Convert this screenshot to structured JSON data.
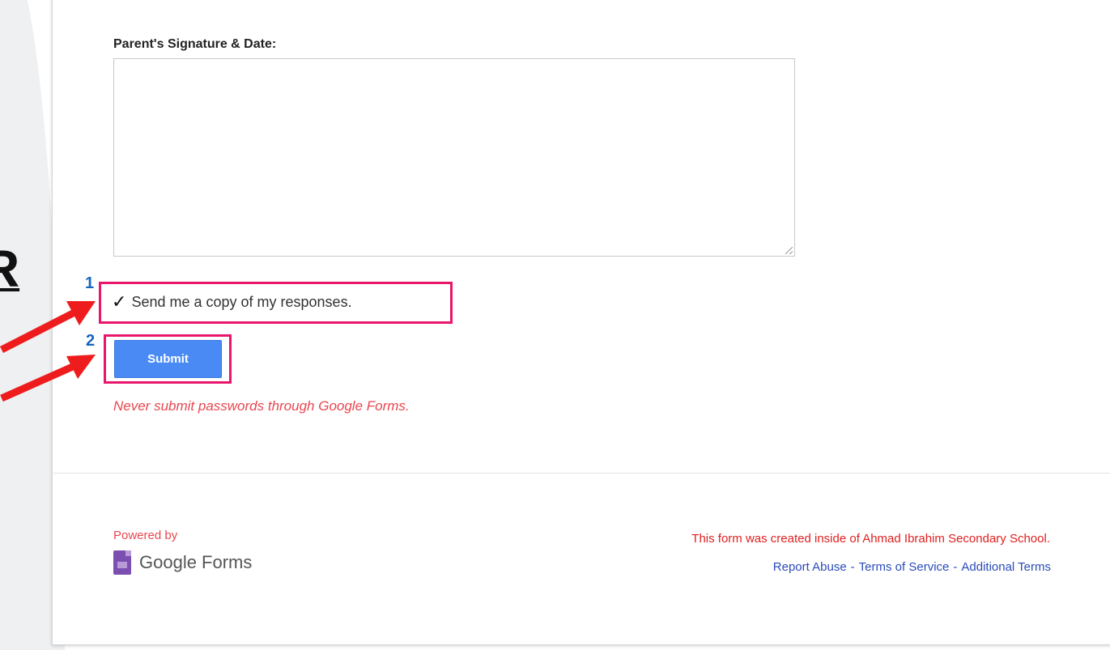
{
  "slide": {
    "partial_letter": "R"
  },
  "form": {
    "field_label": "Parent's Signature & Date:",
    "field_value": "",
    "copy_checkbox": {
      "checked": true,
      "check_glyph": "✓",
      "label": "Send me a copy of my responses."
    },
    "submit_label": "Submit",
    "warning": "Never submit passwords through Google Forms."
  },
  "annotations": {
    "step_1": "1",
    "step_2": "2",
    "highlight_color": "#e8176c",
    "number_color": "#1565c0",
    "arrow_color": "#ee1c1c"
  },
  "footer": {
    "powered_by": "Powered by",
    "brand": "Google Forms",
    "created_note": "This form was created inside of Ahmad Ibrahim Secondary School.",
    "links": {
      "report_abuse": "Report Abuse",
      "terms_of_service": "Terms of Service",
      "additional_terms": "Additional Terms",
      "separator": "-"
    }
  },
  "colors": {
    "submit_bg": "#4a8af4",
    "warning_text": "#e8474f",
    "link_text": "#2a4bb8"
  }
}
